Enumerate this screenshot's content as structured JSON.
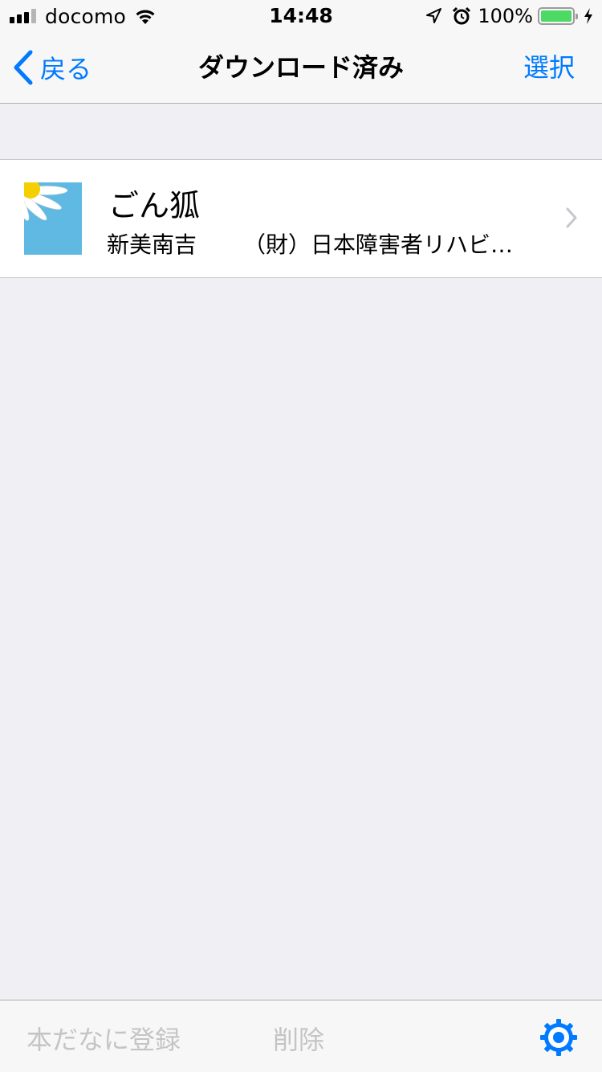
{
  "status_bar": {
    "carrier": "docomo",
    "time": "14:48",
    "battery_percent": "100%",
    "signal_bars": 4,
    "signal_bars_filled": 3,
    "battery_level": 1.0,
    "battery_color": "#4cd964",
    "icons": [
      "signal-icon",
      "wifi-icon",
      "location-arrow-icon",
      "alarm-icon",
      "battery-icon",
      "charging-bolt-icon"
    ]
  },
  "nav": {
    "back_label": "戻る",
    "title": "ダウンロード済み",
    "select_label": "選択",
    "accent_color": "#007aff"
  },
  "books": [
    {
      "title": "ごん狐",
      "author": "新美南吉",
      "publisher": "（財）日本障害者リハビ…",
      "thumbnail_icon": "daisy-cover-icon"
    }
  ],
  "toolbar": {
    "register_label": "本だなに登録",
    "delete_label": "削除",
    "settings_icon": "gear-icon"
  }
}
